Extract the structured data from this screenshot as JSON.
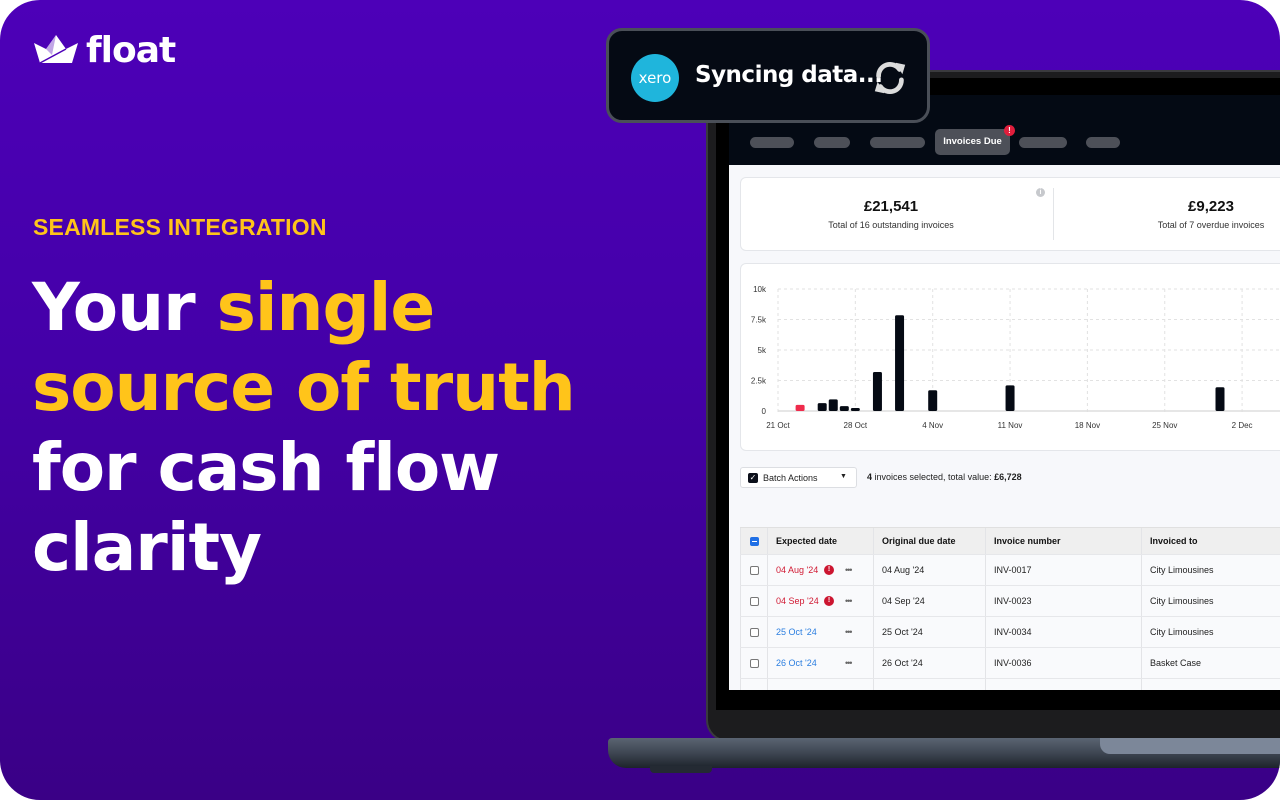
{
  "brand": {
    "name": "float",
    "accent": "#ffc41a",
    "background": "#4d00b8"
  },
  "hero": {
    "eyebrow": "SEAMLESS INTEGRATION",
    "headline": [
      {
        "text": "Your ",
        "highlight": false
      },
      {
        "text": "single source of truth",
        "highlight": true
      },
      {
        "text": " for cash flow clarity",
        "highlight": false
      }
    ],
    "line1_white": "Your ",
    "line1_yellow": "single",
    "line2_yellow": "source of truth",
    "line3_white": "for cash flow",
    "line4_white": "clarity"
  },
  "toast": {
    "integration_logo": "xero",
    "message": "Syncing data...",
    "icon": "sync-icon"
  },
  "app": {
    "nav": {
      "active_tab": "Invoices Due",
      "active_badge": "!"
    },
    "summary": [
      {
        "value": "£21,541",
        "label": "Total of 16 outstanding invoices"
      },
      {
        "value": "£9,223",
        "label": "Total of 7 overdue invoices"
      }
    ],
    "batch": {
      "button_label": "Batch Actions",
      "selected_count": "4",
      "selected_text": " invoices selected, total value: ",
      "selected_total": "£6,728"
    },
    "table": {
      "headers": [
        "Expected date",
        "Original due date",
        "Invoice number",
        "Invoiced to"
      ],
      "rows": [
        {
          "expected": "04 Aug '24",
          "status": "overdue",
          "original": "04 Aug '24",
          "invoice": "INV-0017",
          "to": "City Limousines"
        },
        {
          "expected": "04 Sep '24",
          "status": "overdue",
          "original": "04 Sep '24",
          "invoice": "INV-0023",
          "to": "City Limousines"
        },
        {
          "expected": "25 Oct '24",
          "status": "upcoming",
          "original": "25 Oct '24",
          "invoice": "INV-0034",
          "to": "City Limousines"
        },
        {
          "expected": "26 Oct '24",
          "status": "upcoming",
          "original": "26 Oct '24",
          "invoice": "INV-0036",
          "to": "Basket Case"
        }
      ]
    }
  },
  "chart_data": {
    "type": "bar",
    "title": "",
    "xlabel": "",
    "ylabel": "",
    "ylim": [
      0,
      10000
    ],
    "y_ticks": [
      0,
      2500,
      5000,
      7500,
      10000
    ],
    "y_tick_labels": [
      "0",
      "2.5k",
      "5k",
      "7.5k",
      "10k"
    ],
    "x_ticks_day_offset": [
      0,
      7,
      14,
      21,
      28,
      35,
      42
    ],
    "x_tick_labels": [
      "21 Oct",
      "28 Oct",
      "4 Nov",
      "11 Nov",
      "18 Nov",
      "25 Nov",
      "2 Dec"
    ],
    "x_range_days": [
      -1,
      48
    ],
    "grid": true,
    "bars": [
      {
        "day_offset": 2,
        "value": 500,
        "overdue": true
      },
      {
        "day_offset": 4,
        "value": 650,
        "overdue": false
      },
      {
        "day_offset": 5,
        "value": 950,
        "overdue": false
      },
      {
        "day_offset": 6,
        "value": 400,
        "overdue": false
      },
      {
        "day_offset": 7,
        "value": 250,
        "overdue": false
      },
      {
        "day_offset": 9,
        "value": 3200,
        "overdue": false
      },
      {
        "day_offset": 11,
        "value": 7850,
        "overdue": false
      },
      {
        "day_offset": 14,
        "value": 1700,
        "overdue": false
      },
      {
        "day_offset": 21,
        "value": 2100,
        "overdue": false
      },
      {
        "day_offset": 40,
        "value": 1950,
        "overdue": false
      }
    ],
    "colors": {
      "normal": "#050a14",
      "overdue": "#ef2b4c"
    }
  }
}
